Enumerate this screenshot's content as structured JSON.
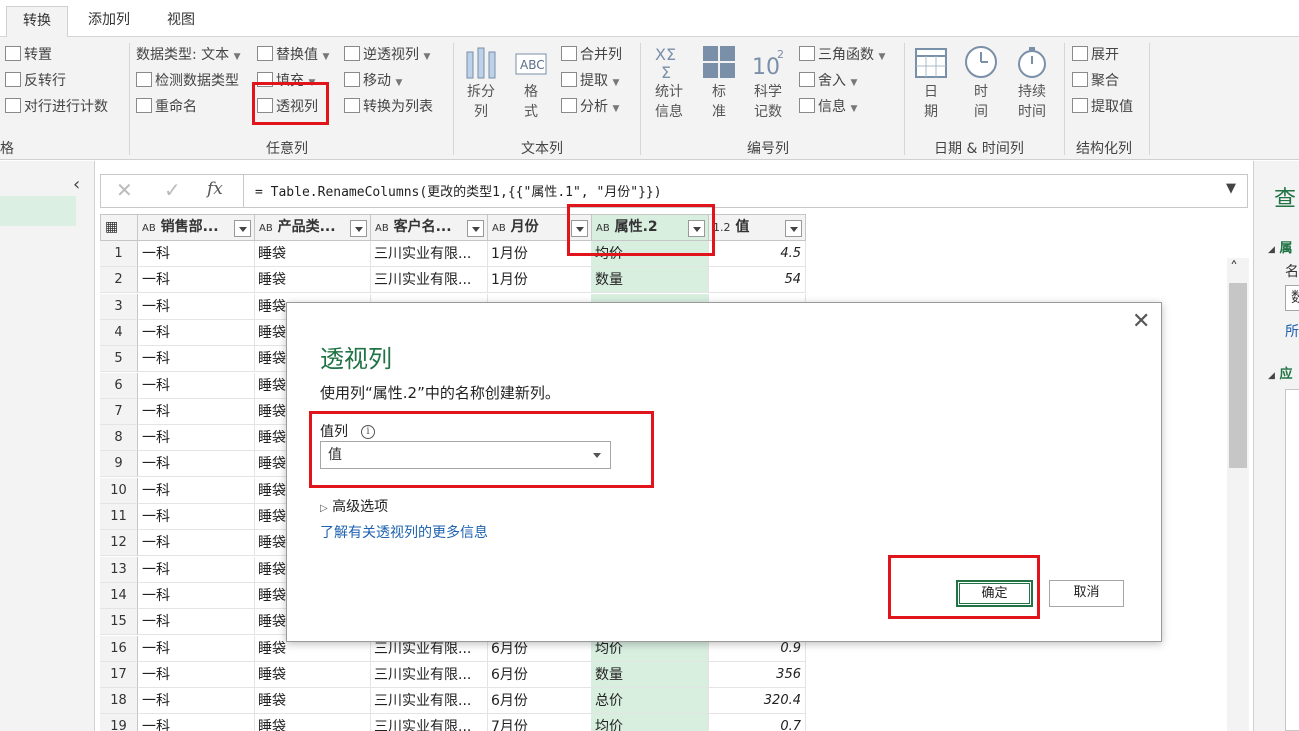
{
  "tabs": [
    "转换",
    "添加列",
    "视图"
  ],
  "ribbon": {
    "table_group": {
      "items": [
        "转置",
        "反转行",
        "对行进行计数"
      ],
      "label": "格"
    },
    "any_col": {
      "col1": [
        "数据类型: 文本",
        "检测数据类型",
        "重命名"
      ],
      "col2": [
        "替换值",
        "填充",
        "透视列"
      ],
      "col3": [
        "逆透视列",
        "移动",
        "转换为列表"
      ],
      "label": "任意列"
    },
    "text_col": {
      "split": [
        "拆分",
        "列"
      ],
      "format": [
        "格",
        "式"
      ],
      "small": [
        "合并列",
        "提取",
        "分析"
      ],
      "label": "文本列"
    },
    "num_col": {
      "stats": [
        "统计",
        "信息"
      ],
      "std": [
        "标",
        "准"
      ],
      "sci": [
        "科学",
        "记数"
      ],
      "small": [
        "三角函数",
        "舍入",
        "信息"
      ],
      "label": "编号列"
    },
    "datetime_col": {
      "date": [
        "日",
        "期"
      ],
      "time": [
        "时",
        "间"
      ],
      "duration": [
        "持续",
        "时间"
      ],
      "label": "日期 & 时间列"
    },
    "struct_col": {
      "items": [
        "展开",
        "聚合",
        "提取值"
      ],
      "label": "结构化列"
    }
  },
  "formula": {
    "text": "= Table.RenameColumns(更改的类型1,{{\"属性.1\", \"月份\"}})"
  },
  "table": {
    "headers": [
      "销售部...",
      "产品类...",
      "客户名...",
      "月份",
      "属性.2",
      "值"
    ],
    "header_prefix": "AB",
    "header_prefix_num": "1.2",
    "rows": [
      {
        "n": "1",
        "a": "一科",
        "b": "睡袋",
        "c": "三川实业有限...",
        "d": "1月份",
        "e": "均价",
        "f": "4.5"
      },
      {
        "n": "2",
        "a": "一科",
        "b": "睡袋",
        "c": "三川实业有限...",
        "d": "1月份",
        "e": "数量",
        "f": "54"
      },
      {
        "n": "3",
        "a": "一科",
        "b": "睡袋"
      },
      {
        "n": "4",
        "a": "一科",
        "b": "睡袋"
      },
      {
        "n": "5",
        "a": "一科",
        "b": "睡袋"
      },
      {
        "n": "6",
        "a": "一科",
        "b": "睡袋"
      },
      {
        "n": "7",
        "a": "一科",
        "b": "睡袋"
      },
      {
        "n": "8",
        "a": "一科",
        "b": "睡袋"
      },
      {
        "n": "9",
        "a": "一科",
        "b": "睡袋"
      },
      {
        "n": "10",
        "a": "一科",
        "b": "睡袋"
      },
      {
        "n": "11",
        "a": "一科",
        "b": "睡袋"
      },
      {
        "n": "12",
        "a": "一科",
        "b": "睡袋"
      },
      {
        "n": "13",
        "a": "一科",
        "b": "睡袋"
      },
      {
        "n": "14",
        "a": "一科",
        "b": "睡袋"
      },
      {
        "n": "15",
        "a": "一科",
        "b": "睡袋"
      },
      {
        "n": "16",
        "a": "一科",
        "b": "睡袋",
        "c": "三川实业有限...",
        "d": "6月份",
        "e": "均价",
        "f": "0.9"
      },
      {
        "n": "17",
        "a": "一科",
        "b": "睡袋",
        "c": "三川实业有限...",
        "d": "6月份",
        "e": "数量",
        "f": "356"
      },
      {
        "n": "18",
        "a": "一科",
        "b": "睡袋",
        "c": "三川实业有限...",
        "d": "6月份",
        "e": "总价",
        "f": "320.4"
      },
      {
        "n": "19",
        "a": "一科",
        "b": "睡袋",
        "c": "三川实业有限...",
        "d": "7月份",
        "e": "均价",
        "f": "0.7"
      }
    ]
  },
  "right_pane": {
    "title": "查",
    "s1": "属",
    "s1_name": "名",
    "s1_input": "数",
    "s1_link": "所",
    "s2": "应"
  },
  "dialog": {
    "title": "透视列",
    "description": "使用列“属性.2”中的名称创建新列。",
    "value_col_label": "值列",
    "value_col_selected": "值",
    "advanced": "高级选项",
    "learn_more": "了解有关透视列的更多信息",
    "ok": "确定",
    "cancel": "取消"
  },
  "colors": {
    "accent": "#217346",
    "highlight": "#e1141b",
    "selected_col": "#d8efe0"
  }
}
